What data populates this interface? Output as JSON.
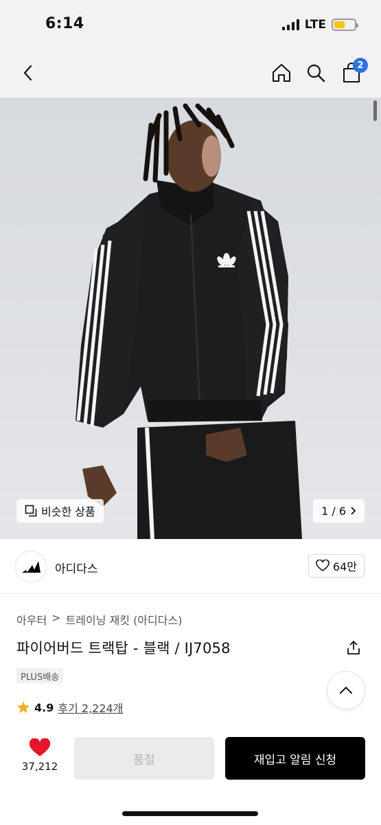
{
  "status_bar": {
    "time": "6:14",
    "network": "LTE"
  },
  "nav": {
    "cart_count": "2"
  },
  "hero": {
    "similar_label": "비슷한 상품",
    "page_indicator": "1 / 6"
  },
  "brand": {
    "name": "아디다스",
    "likes": "64만"
  },
  "breadcrumb": {
    "level1": "아우터",
    "separator": ">",
    "level2": "트레이닝 재킷 (아디다스)"
  },
  "product": {
    "title": "파이어버드 트랙탑 - 블랙 / IJ7058",
    "badge": "PLUS배송",
    "rating": "4.9",
    "reviews": "후기 2,224개"
  },
  "bottom": {
    "wish_count": "37,212",
    "soldout_label": "품절",
    "restock_label": "재입고 알림 신청"
  },
  "colors": {
    "accent": "#2f6fe8",
    "heart": "#e8132c",
    "star": "#f2b01e",
    "primary_button": "#000000"
  }
}
